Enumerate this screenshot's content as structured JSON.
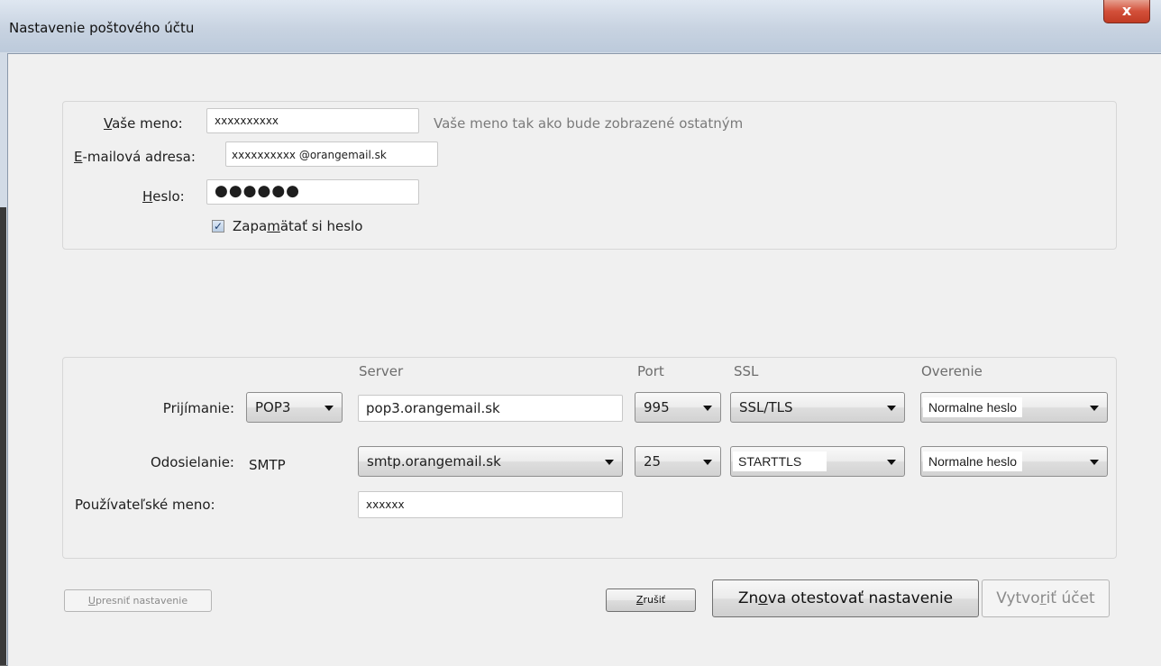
{
  "window": {
    "title": "Nastavenie poštového účtu",
    "close_glyph": "x"
  },
  "identity": {
    "name_label_u": "V",
    "name_label_rest": "aše meno:",
    "name_value": "xxxxxxxxxx",
    "name_hint": "Vaše meno tak ako bude zobrazené ostatným",
    "email_label_u": "E",
    "email_label_rest": "-mailová adresa:",
    "email_value": "xxxxxxxxxx @orangemail.sk",
    "password_label_u": "H",
    "password_label_rest": "eslo:",
    "password_value": "●●●●●●",
    "remember_pre": "Zapa",
    "remember_u": "m",
    "remember_post": "ätať si heslo",
    "remember_checked": true,
    "check_glyph": "✓"
  },
  "server": {
    "columns": {
      "server": "Server",
      "port": "Port",
      "ssl": "SSL",
      "auth": "Overenie"
    },
    "incoming": {
      "label": "Prijímanie:",
      "protocol": "POP3",
      "server": "pop3.orangemail.sk",
      "port": "995",
      "ssl": "SSL/TLS",
      "auth": "Normalne heslo"
    },
    "outgoing": {
      "label": "Odosielanie:",
      "protocol": "SMTP",
      "server": "smtp.orangemail.sk",
      "port": "25",
      "ssl": "STARTTLS",
      "auth": "Normalne heslo"
    },
    "username_label": "Používateľské meno:",
    "username_value": "xxxxxx"
  },
  "buttons": {
    "advanced_u": "U",
    "advanced_rest": "presniť nastavenie",
    "cancel_u": "Z",
    "cancel_rest": "rušiť",
    "retest_pre": "Zn",
    "retest_u": "o",
    "retest_post": "va otestovať nastavenie",
    "create_pre": "Vytvo",
    "create_u": "r",
    "create_post": "iť účet"
  }
}
